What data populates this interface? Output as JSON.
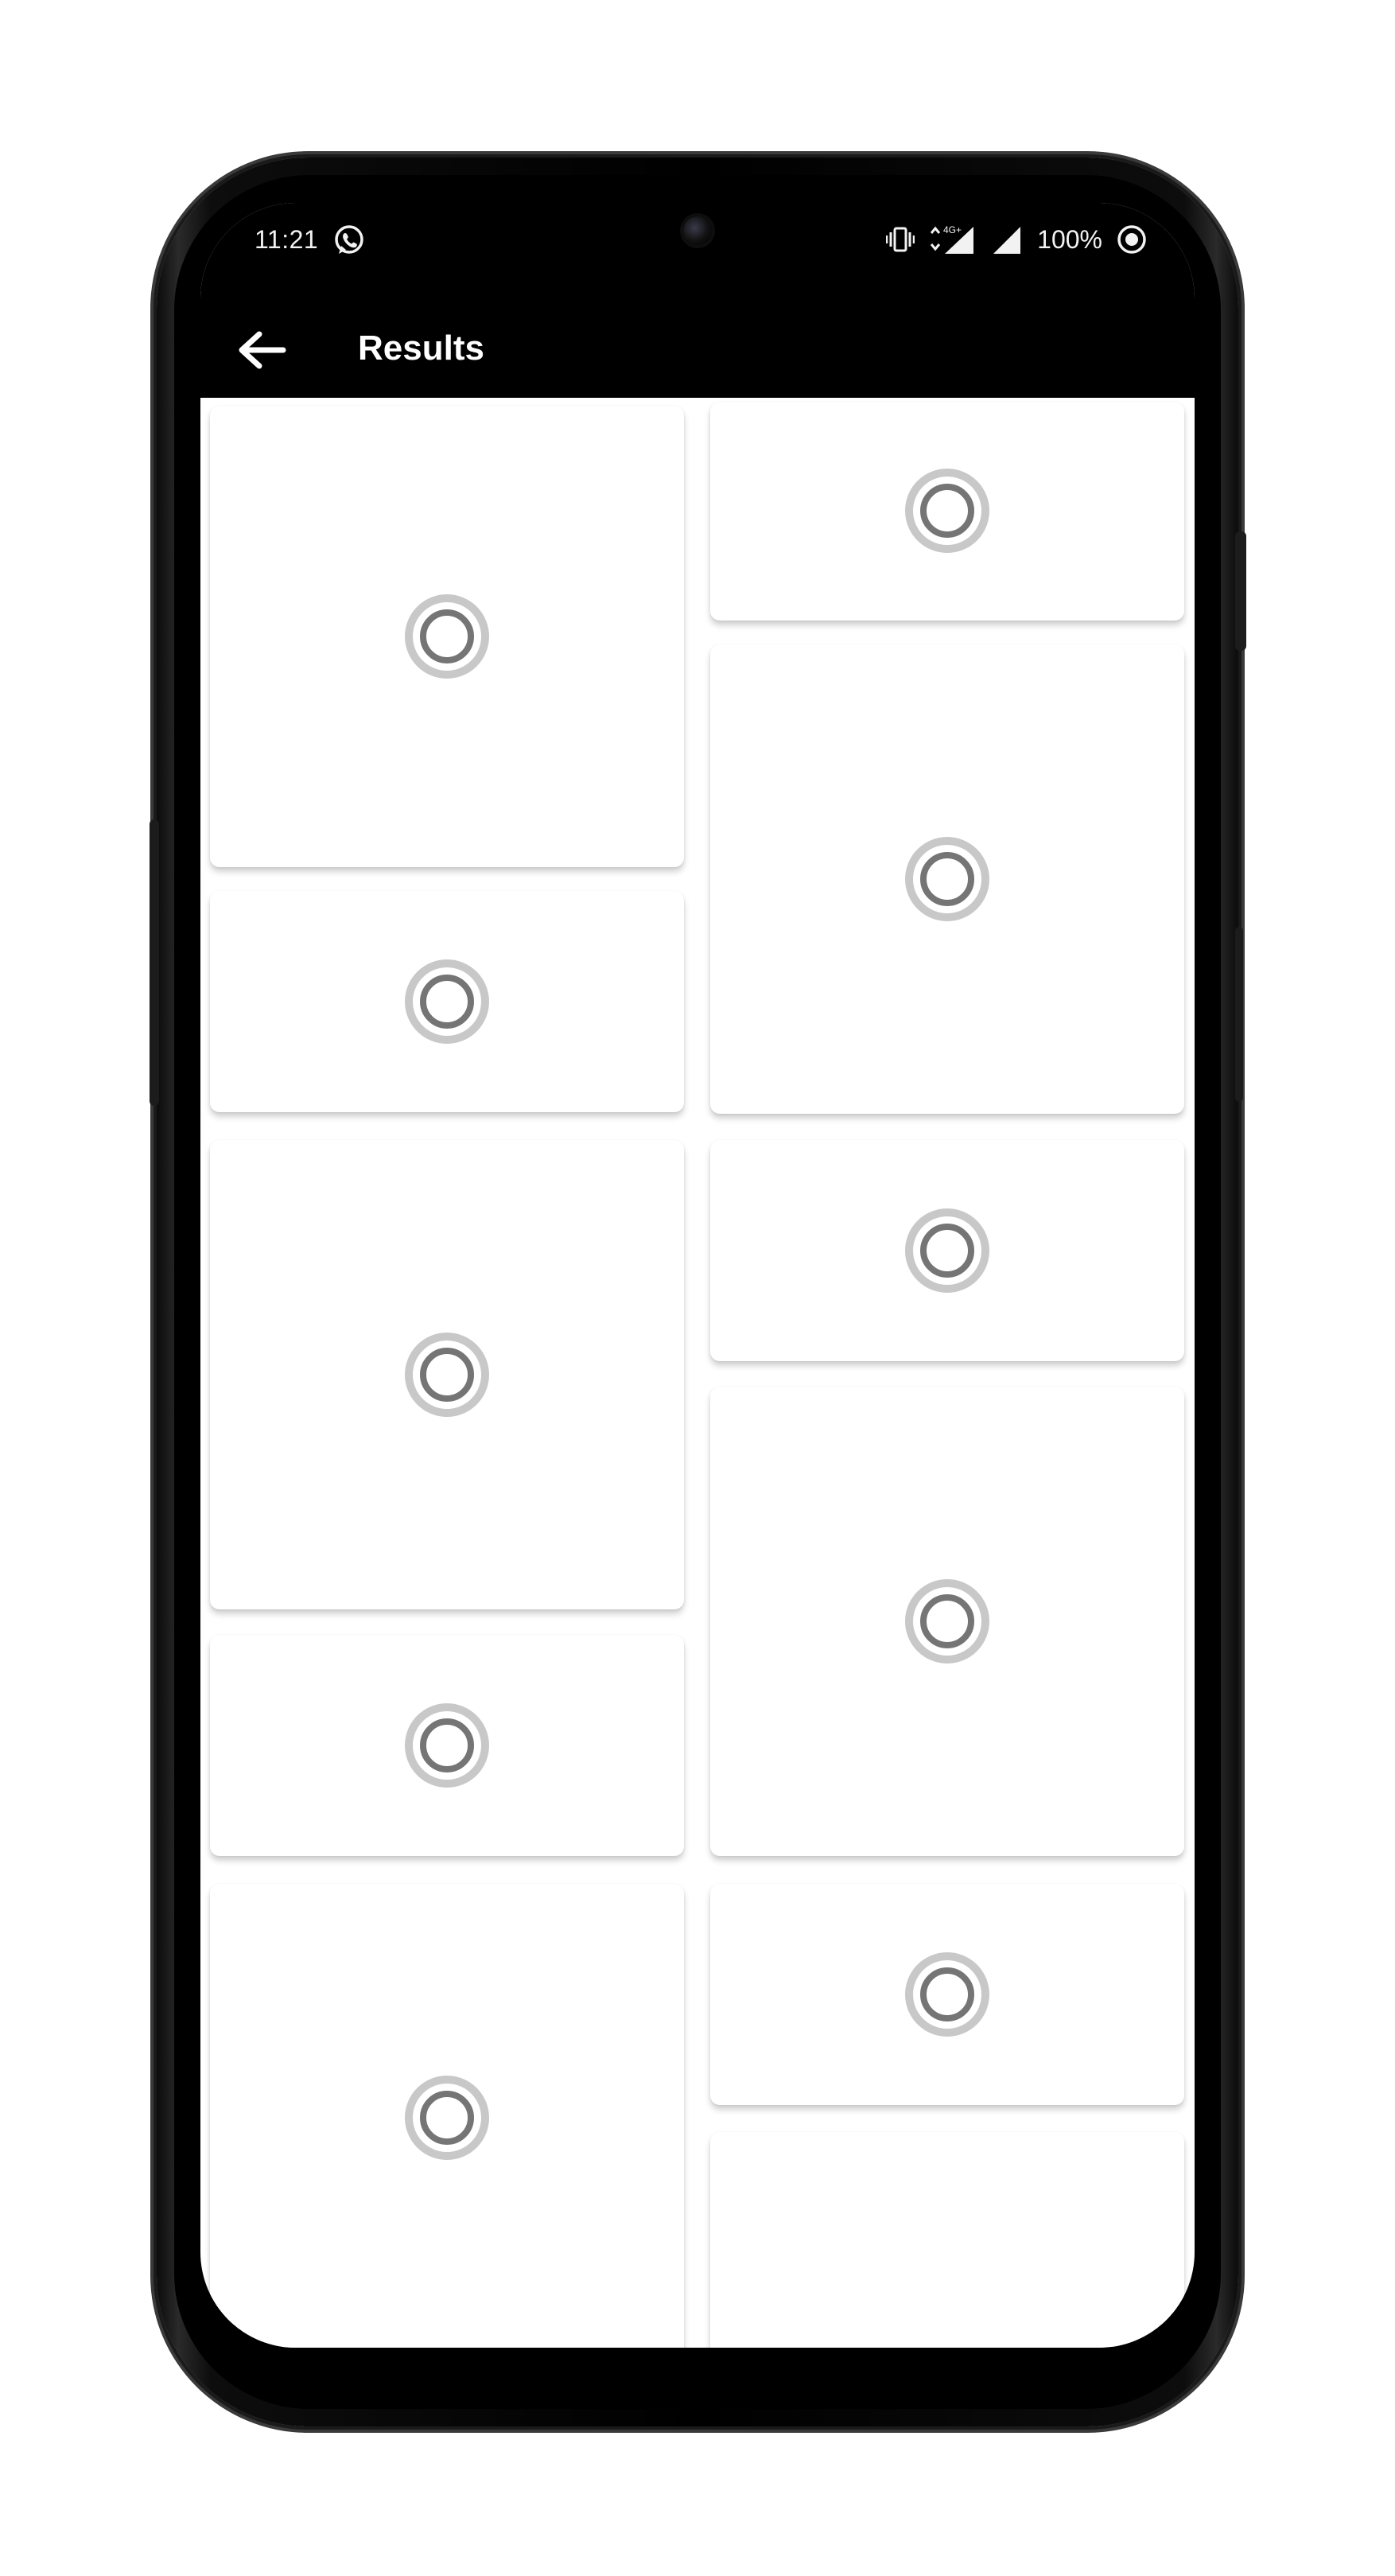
{
  "status_bar": {
    "time": "11:21",
    "network_label": "4G+",
    "battery_percent": "100%",
    "icons": [
      "whatsapp-icon",
      "vibrate-icon",
      "data-arrows-icon",
      "signal-icon",
      "signal-icon",
      "battery-saver-icon"
    ]
  },
  "app_bar": {
    "title": "Results",
    "back_icon": "arrow-left-icon"
  },
  "results": {
    "card_state": "loading",
    "card_icon": "loading-spinner-icon",
    "left_column": [
      {
        "id": "result-1"
      },
      {
        "id": "result-3"
      },
      {
        "id": "result-5"
      },
      {
        "id": "result-7"
      },
      {
        "id": "result-9"
      }
    ],
    "right_column": [
      {
        "id": "result-2"
      },
      {
        "id": "result-4"
      },
      {
        "id": "result-6"
      },
      {
        "id": "result-8"
      },
      {
        "id": "result-10"
      },
      {
        "id": "result-12"
      }
    ]
  },
  "colors": {
    "app_bar": "#000000",
    "card": "#ffffff",
    "spinner_track": "#c8c8c8",
    "spinner_ring": "#757575"
  }
}
